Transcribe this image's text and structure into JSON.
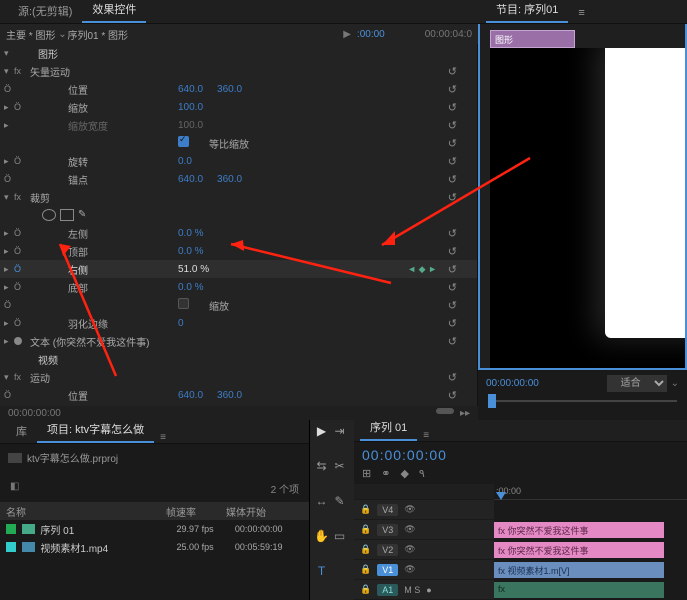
{
  "header": {
    "source_tab": "源:(无剪辑)",
    "effects_tab": "效果控件",
    "program_tab": "节目: 序列01"
  },
  "crumb": {
    "main_graphic": "主要 * 图形",
    "seq_graphic": "序列01 * 图形"
  },
  "ruler": {
    "t0": ":00:00",
    "t1": "00:00:04:0"
  },
  "props": {
    "graphic": "图形",
    "vector_motion": "矢量运动",
    "position": "位置",
    "pos_x": "640.0",
    "pos_y": "360.0",
    "scale": "缩放",
    "scale_v": "100.0",
    "scale_w": "缩放宽度",
    "scale_w_v": "100.0",
    "uniform": "等比缩放",
    "rotation": "旋转",
    "rotation_v": "0.0",
    "anchor": "锚点",
    "anc_x": "640.0",
    "anc_y": "360.0",
    "crop": "裁剪",
    "left": "左侧",
    "left_v": "0.0 %",
    "top": "顶部",
    "top_v": "0.0 %",
    "right": "右侧",
    "right_v": "51.0 %",
    "bottom": "底部",
    "bottom_v": "0.0 %",
    "crop_scale": "缩放",
    "feather": "羽化边缘",
    "feather_v": "0",
    "text": "文本 (你突然不爱我这件事)",
    "video": "视频",
    "motion": "运动"
  },
  "preview": {
    "clip_label": "图形",
    "tc": "00:00:00:00",
    "fit": "适合"
  },
  "bin": {
    "tab_lib": "库",
    "tab_proj": "项目: ktv字幕怎么做",
    "proj_name": "ktv字幕怎么做.prproj",
    "count": "2 个项",
    "h_name": "名称",
    "h_rate": "帧速率",
    "h_start": "媒体开始",
    "r1_name": "序列 01",
    "r1_rate": "29.97 fps",
    "r1_start": "00:00:00:00",
    "r2_name": "视频素材1.mp4",
    "r2_rate": "25.00 fps",
    "r2_start": "00:05:59:19"
  },
  "timeline": {
    "tab": "序列 01",
    "tc": "00:00:00:00",
    "ruler_t0": ":00:00",
    "v4": "V4",
    "v3": "V3",
    "v2": "V2",
    "v1": "V1",
    "a1": "A1",
    "ms": "M  S",
    "clip_pink1": "你突然不爱我这件事",
    "clip_pink2": "你突然不爱我这件事",
    "clip_blue": "视频素材1.m[V]",
    "fx": "fx"
  }
}
